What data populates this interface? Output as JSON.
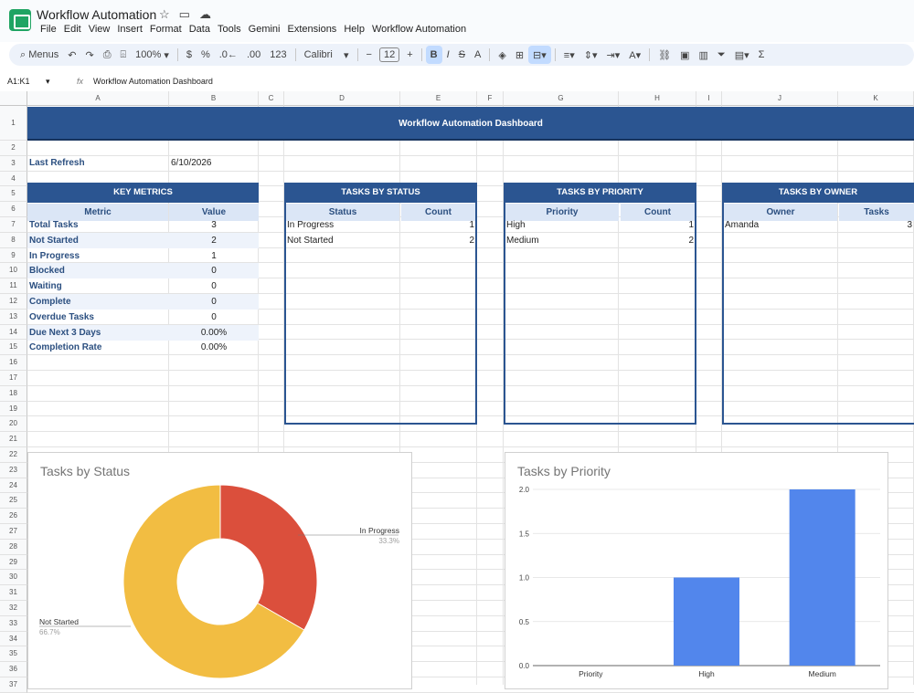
{
  "app": {
    "title": "Workflow Automation",
    "menus": [
      "File",
      "Edit",
      "View",
      "Insert",
      "Format",
      "Data",
      "Tools",
      "Gemini",
      "Extensions",
      "Help",
      "Workflow Automation"
    ]
  },
  "toolbar": {
    "search_label": "Menus",
    "zoom": "100%",
    "font": "Calibri",
    "font_size": "12",
    "number_format": "123",
    "currency": "$",
    "percent": "%"
  },
  "formula_bar": {
    "name_box": "A1:K1",
    "content": "Workflow Automation Dashboard"
  },
  "grid": {
    "columns": [
      "A",
      "B",
      "C",
      "D",
      "E",
      "F",
      "G",
      "H",
      "I",
      "J",
      "K"
    ],
    "rows": [
      "1",
      "2",
      "3",
      "4",
      "5",
      "6",
      "7",
      "8",
      "9",
      "10",
      "11",
      "12",
      "13",
      "14",
      "15",
      "16",
      "17",
      "18",
      "19",
      "20",
      "21",
      "22",
      "23",
      "24",
      "25",
      "26",
      "27",
      "28",
      "29",
      "30",
      "31",
      "32",
      "33",
      "34",
      "35",
      "36",
      "37"
    ]
  },
  "dashboard": {
    "title": "Workflow Automation Dashboard",
    "last_refresh_label": "Last Refresh",
    "last_refresh_value": "6/10/2026",
    "key_metrics": {
      "header": "KEY METRICS",
      "col_metric": "Metric",
      "col_value": "Value",
      "rows": [
        {
          "metric": "Total Tasks",
          "value": "3"
        },
        {
          "metric": "Not Started",
          "value": "2"
        },
        {
          "metric": "In Progress",
          "value": "1"
        },
        {
          "metric": "Blocked",
          "value": "0"
        },
        {
          "metric": "Waiting",
          "value": "0"
        },
        {
          "metric": "Complete",
          "value": "0"
        },
        {
          "metric": "Overdue Tasks",
          "value": "0"
        },
        {
          "metric": "Due Next 3 Days",
          "value": "0.00%"
        },
        {
          "metric": "Completion Rate",
          "value": "0.00%"
        }
      ]
    },
    "tasks_by_status": {
      "header": "TASKS BY STATUS",
      "col_a": "Status",
      "col_b": "Count",
      "rows": [
        {
          "label": "In Progress",
          "count": "1"
        },
        {
          "label": "Not Started",
          "count": "2"
        }
      ]
    },
    "tasks_by_priority": {
      "header": "TASKS BY PRIORITY",
      "col_a": "Priority",
      "col_b": "Count",
      "rows": [
        {
          "label": "High",
          "count": "1"
        },
        {
          "label": "Medium",
          "count": "2"
        }
      ]
    },
    "tasks_by_owner": {
      "header": "TASKS BY OWNER",
      "col_a": "Owner",
      "col_b": "Tasks",
      "rows": [
        {
          "label": "Amanda",
          "count": "3"
        }
      ]
    }
  },
  "chart_data": [
    {
      "type": "pie",
      "title": "Tasks by Status",
      "donut": true,
      "slices": [
        {
          "label": "In Progress",
          "value": 1,
          "percent_label": "33.3%",
          "color": "#db4f3c"
        },
        {
          "label": "Not Started",
          "value": 2,
          "percent_label": "66.7%",
          "color": "#f2bd42"
        }
      ]
    },
    {
      "type": "bar",
      "title": "Tasks by Priority",
      "categories": [
        "Priority",
        "High",
        "Medium"
      ],
      "values": [
        0,
        1,
        2
      ],
      "ylim": [
        0,
        2
      ],
      "yticks": [
        "0.0",
        "0.5",
        "1.0",
        "1.5",
        "2.0"
      ],
      "color": "#5286ec",
      "grid": true
    }
  ]
}
